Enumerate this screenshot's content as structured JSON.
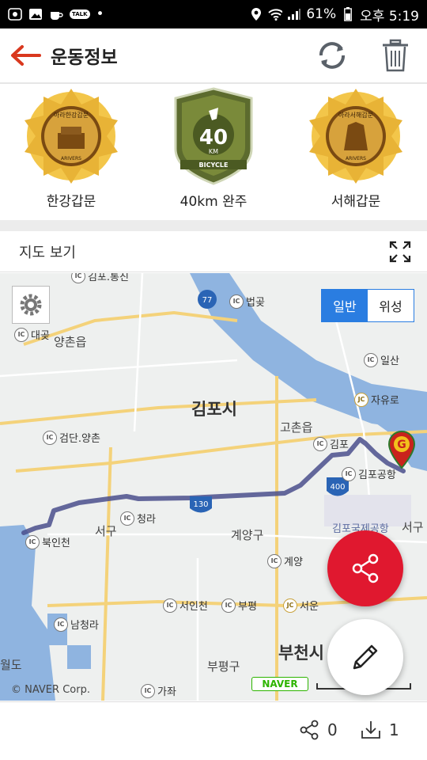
{
  "status_bar": {
    "battery": "61%",
    "time": "오후 5:19",
    "talk_label": "TALK"
  },
  "app_bar": {
    "title": "운동정보",
    "back_icon": "arrow-left-icon",
    "refresh_icon": "refresh-icon",
    "delete_icon": "trash-icon"
  },
  "badges": [
    {
      "label": "한강갑문",
      "emblem_text": "아라한강갑문",
      "emblem_sub": "ARIVERS"
    },
    {
      "label": "40km 완주",
      "emblem_text": "40",
      "emblem_unit": "KM",
      "emblem_sub": "BICYCLE"
    },
    {
      "label": "서해갑문",
      "emblem_text": "아라서해갑문",
      "emblem_sub": "ARIVERS"
    }
  ],
  "map_section": {
    "title": "지도 보기",
    "map_type": {
      "normal": "일반",
      "satellite": "위성",
      "selected": "일반"
    },
    "copyright": "© NAVER Corp.",
    "naver_logo": "NAVER",
    "labels": {
      "city_gimpo": "김포시",
      "gochon": "고촌읍",
      "yangchon": "양촌읍",
      "seogu": "서구",
      "seogu2": "서구",
      "gyeyang": "계양구",
      "bucheon": "부천시",
      "bupyeong": "부평구",
      "airport": "김포국제공항",
      "daegot": "대곶",
      "gimpotong": "김포.통진",
      "wido": "월도"
    },
    "ic_labels": {
      "gimpotongjin": "김포.통진",
      "beopgot": "법곶",
      "daegot": "대곶",
      "ilsan": "일산",
      "jayuro": "자유로",
      "geomdan": "검단.양촌",
      "gimpo": "김포",
      "gimpo_airport": "김포공항",
      "cheongna": "청라",
      "bukincheon": "북인천",
      "gyeyang": "계양",
      "seoincheon": "서인천",
      "bupyeong": "부평",
      "seoun": "서운",
      "namcheongna": "남청라",
      "gajwa": "가좌"
    },
    "road_numbers": {
      "r77": "77",
      "r400": "400",
      "r130": "130"
    },
    "route_color": "#4a4f8c",
    "marker_letter": "G"
  },
  "bottom_bar": {
    "share_count": "0",
    "download_count": "1"
  },
  "colors": {
    "accent_red": "#e0182f",
    "back_arrow": "#d9381e",
    "selected_tab": "#2a7de1",
    "water": "#8fb4e0"
  }
}
